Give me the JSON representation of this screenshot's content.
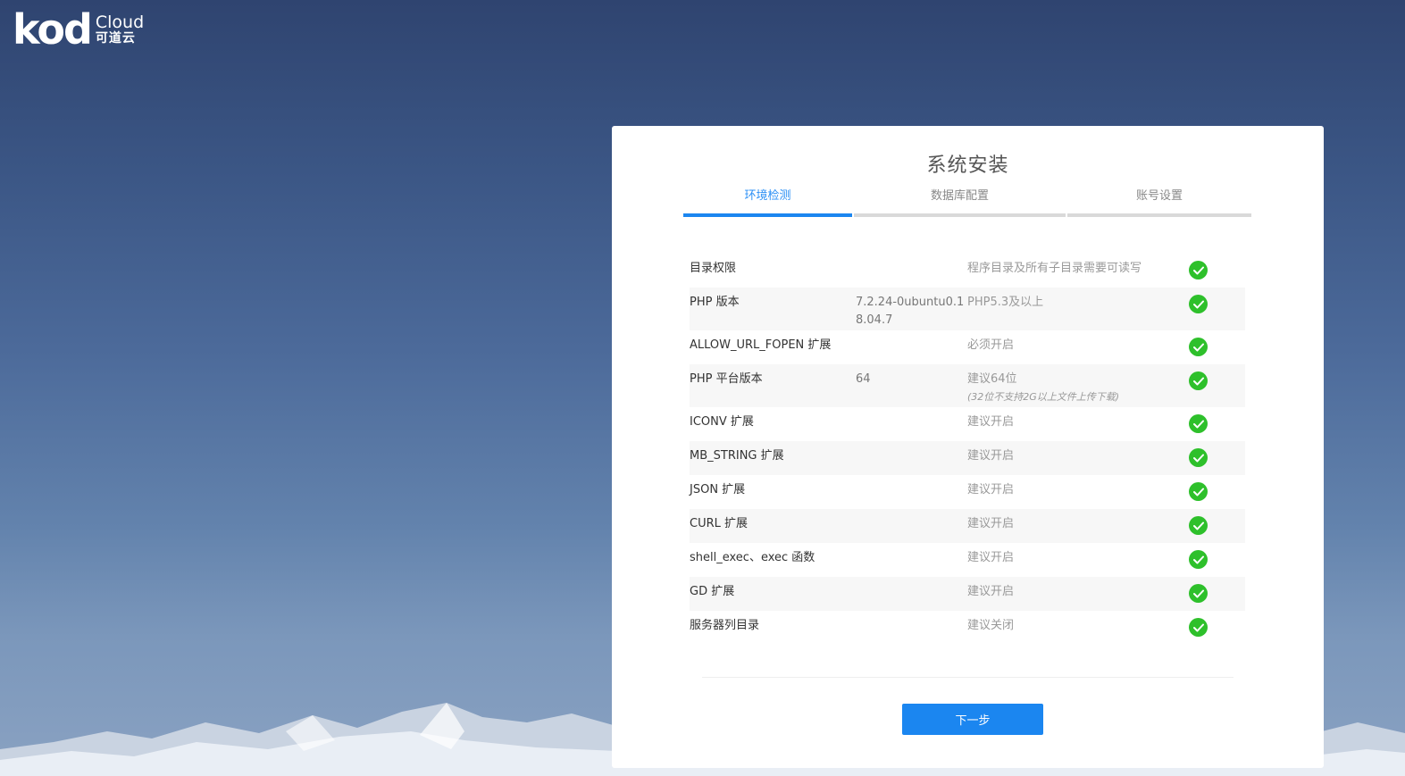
{
  "logo": {
    "main": "kod",
    "cloud": "Cloud",
    "cn": "可道云"
  },
  "panel": {
    "title": "系统安装",
    "steps": [
      {
        "label": "环境检测",
        "active": true
      },
      {
        "label": "数据库配置",
        "active": false
      },
      {
        "label": "账号设置",
        "active": false
      }
    ]
  },
  "checks": [
    {
      "name": "目录权限",
      "value": "",
      "requirement": "程序目录及所有子目录需要可读写",
      "note": "",
      "status": "ok"
    },
    {
      "name": "PHP 版本",
      "value": "7.2.24-0ubuntu0.18.04.7",
      "requirement": "PHP5.3及以上",
      "note": "",
      "status": "ok"
    },
    {
      "name": "ALLOW_URL_FOPEN 扩展",
      "value": "",
      "requirement": "必须开启",
      "note": "",
      "status": "ok"
    },
    {
      "name": "PHP 平台版本",
      "value": "64",
      "requirement": "建议64位",
      "note": "(32位不支持2G以上文件上传下载)",
      "status": "ok"
    },
    {
      "name": "ICONV 扩展",
      "value": "",
      "requirement": "建议开启",
      "note": "",
      "status": "ok"
    },
    {
      "name": "MB_STRING 扩展",
      "value": "",
      "requirement": "建议开启",
      "note": "",
      "status": "ok"
    },
    {
      "name": "JSON 扩展",
      "value": "",
      "requirement": "建议开启",
      "note": "",
      "status": "ok"
    },
    {
      "name": "CURL 扩展",
      "value": "",
      "requirement": "建议开启",
      "note": "",
      "status": "ok"
    },
    {
      "name": "shell_exec、exec 函数",
      "value": "",
      "requirement": "建议开启",
      "note": "",
      "status": "ok"
    },
    {
      "name": "GD 扩展",
      "value": "",
      "requirement": "建议开启",
      "note": "",
      "status": "ok"
    },
    {
      "name": "服务器列目录",
      "value": "",
      "requirement": "建议关闭",
      "note": "",
      "status": "ok"
    }
  ],
  "next_button": "下一步",
  "colors": {
    "accent": "#1b86f0",
    "ok": "#2ec02b"
  },
  "icons": {
    "status_ok": "check-circle-icon"
  }
}
